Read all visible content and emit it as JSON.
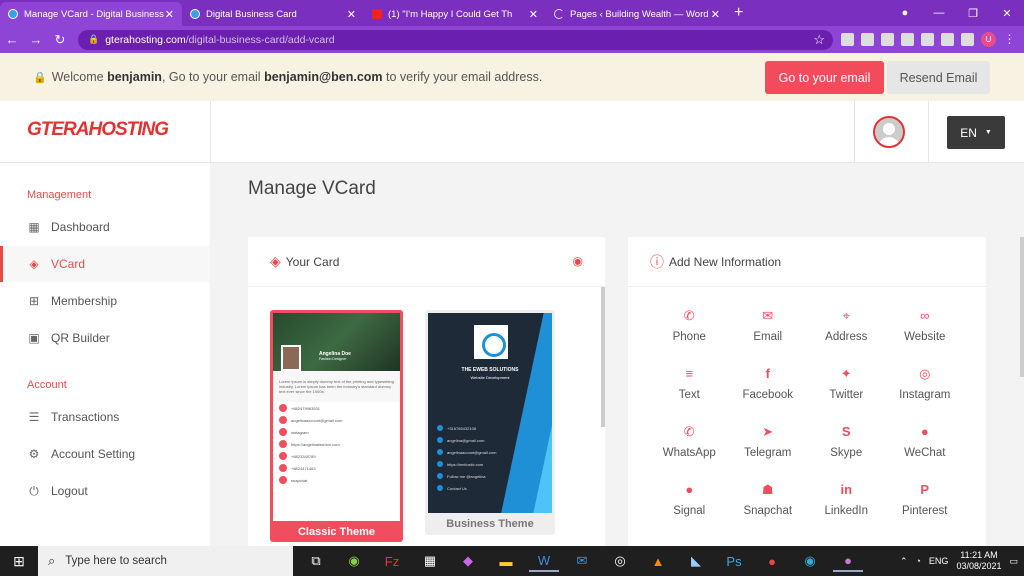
{
  "browser": {
    "tabs": [
      {
        "title": "Manage VCard - Digital Business",
        "active": true
      },
      {
        "title": "Digital Business Card",
        "active": false
      },
      {
        "title": "(1) \"I'm Happy I Could Get Th",
        "active": false
      },
      {
        "title": "Pages ‹ Building Wealth — Word",
        "active": false
      }
    ],
    "url_host": "gterahosting.com",
    "url_path": "/digital-business-card/add-vcard",
    "profile_initial": "U"
  },
  "verify_bar": {
    "prefix": "Welcome",
    "username": "benjamin",
    "middle": ", Go to your email",
    "email": "benjamin@ben.com",
    "suffix": "to verify your email address.",
    "goto_label": "Go to your email",
    "resend_label": "Resend Email"
  },
  "header": {
    "logo_text": "GTERAHOSTING",
    "lang": "EN"
  },
  "sidebar": {
    "management_label": "Management",
    "management_items": [
      {
        "label": "Dashboard",
        "icon": "grid-icon"
      },
      {
        "label": "VCard",
        "icon": "layers-icon",
        "active": true
      },
      {
        "label": "Membership",
        "icon": "gift-icon"
      },
      {
        "label": "QR Builder",
        "icon": "qr-icon"
      }
    ],
    "account_label": "Account",
    "account_items": [
      {
        "label": "Transactions",
        "icon": "list-icon"
      },
      {
        "label": "Account Setting",
        "icon": "gear-icon"
      },
      {
        "label": "Logout",
        "icon": "power-icon"
      }
    ]
  },
  "main": {
    "page_title": "Manage VCard",
    "your_card_title": "Your Card",
    "add_info_title": "Add New Information",
    "themes": [
      {
        "label": "Classic Theme"
      },
      {
        "label": "Business Theme"
      }
    ],
    "classic_preview": {
      "name": "Angelina Doe",
      "role": "Fashion Designer",
      "about": "Lorem ipsum is simply dummy text of the printing and typesetting industry. Lorem ipsum has been the industry's standard dummy text ever since the 1500s.",
      "rows": [
        "+882479983531",
        "angelinaaccount@gmail.com",
        "instagram",
        "https://angelinafashion.com",
        "+8823345789",
        "+8824471463",
        "snapchat"
      ]
    },
    "business_preview": {
      "company": "THE EWEB SOLUTIONS",
      "tagline": "Website Development",
      "rows": [
        "+316765432108",
        "angelina@gmail.com",
        "angelinaacount@gmail.com",
        "https://ientiostic.com",
        "Follow me @angelina",
        "Contact Us"
      ]
    },
    "info_items": [
      {
        "label": "Phone",
        "glyph": "✆"
      },
      {
        "label": "Email",
        "glyph": "✉"
      },
      {
        "label": "Address",
        "glyph": "⌖"
      },
      {
        "label": "Website",
        "glyph": "∞"
      },
      {
        "label": "Text",
        "glyph": "≡"
      },
      {
        "label": "Facebook",
        "glyph": "f"
      },
      {
        "label": "Twitter",
        "glyph": "✦"
      },
      {
        "label": "Instagram",
        "glyph": "◎"
      },
      {
        "label": "WhatsApp",
        "glyph": "✆"
      },
      {
        "label": "Telegram",
        "glyph": "➤"
      },
      {
        "label": "Skype",
        "glyph": "S"
      },
      {
        "label": "WeChat",
        "glyph": "●"
      },
      {
        "label": "Signal",
        "glyph": "●"
      },
      {
        "label": "Snapchat",
        "glyph": "☗"
      },
      {
        "label": "LinkedIn",
        "glyph": "in"
      },
      {
        "label": "Pinterest",
        "glyph": "P"
      }
    ]
  },
  "taskbar": {
    "search_placeholder": "Type here to search",
    "lang": "ENG",
    "time": "11:21 AM",
    "date": "03/08/2021"
  },
  "colors": {
    "accent": "#f04d5e",
    "browser": "#8e44d4"
  }
}
